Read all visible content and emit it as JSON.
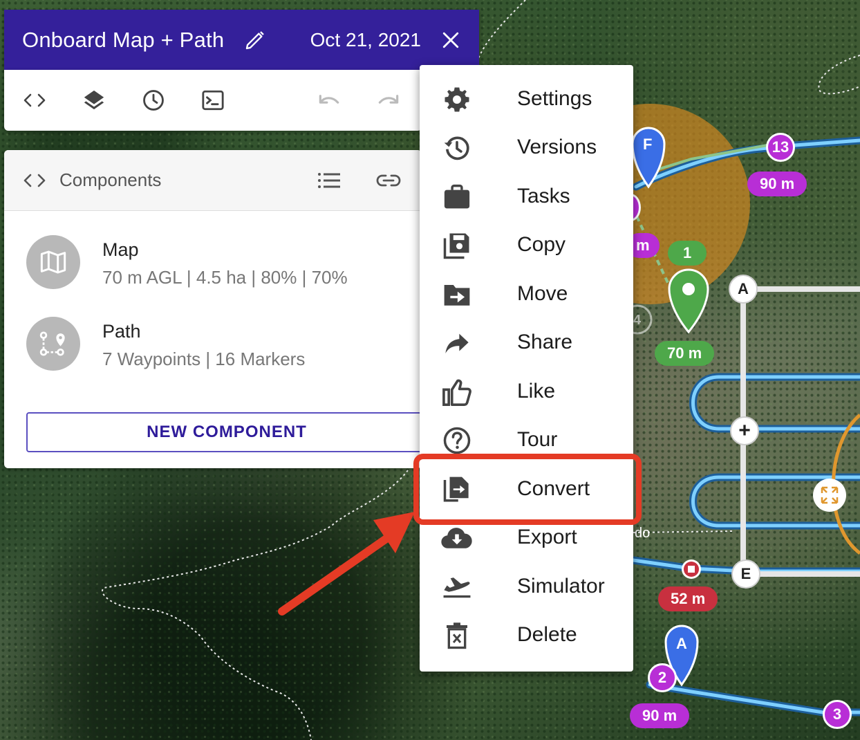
{
  "header": {
    "title": "Onboard Map + Path",
    "date": "Oct 21, 2021"
  },
  "panel": {
    "title": "Components",
    "components": [
      {
        "name": "Map",
        "meta": "70 m AGL | 4.5 ha | 80% | 70%",
        "icon": "map-icon"
      },
      {
        "name": "Path",
        "meta": "7 Waypoints | 16 Markers",
        "icon": "route-icon"
      }
    ],
    "new_button": "NEW COMPONENT"
  },
  "menu": {
    "items": [
      {
        "label": "Settings",
        "icon": "gear-icon"
      },
      {
        "label": "Versions",
        "icon": "history-icon"
      },
      {
        "label": "Tasks",
        "icon": "briefcase-icon"
      },
      {
        "label": "Copy",
        "icon": "save-copy-icon"
      },
      {
        "label": "Move",
        "icon": "folder-move-icon"
      },
      {
        "label": "Share",
        "icon": "share-arrow-icon"
      },
      {
        "label": "Like",
        "icon": "thumbs-up-icon"
      },
      {
        "label": "Tour",
        "icon": "help-circle-icon"
      },
      {
        "label": "Convert",
        "icon": "file-convert-icon"
      },
      {
        "label": "Export",
        "icon": "cloud-download-icon"
      },
      {
        "label": "Simulator",
        "icon": "airplane-takeoff-icon"
      },
      {
        "label": "Delete",
        "icon": "trash-icon"
      }
    ],
    "highlighted": "Convert"
  },
  "map": {
    "markers": {
      "pin_f": "F",
      "pin_a": "A",
      "wp_13": "13",
      "wp_2": "2",
      "wp_3": "3",
      "wp_1": "1",
      "alt_90_top": "90 m",
      "alt_90_bottom": "90 m",
      "alt_70": "70 m",
      "alt_52": "52 m",
      "alt_partial": "m",
      "corner_a": "A",
      "corner_e": "E",
      "plus": "+",
      "partial_4": "4",
      "road_label": "do"
    },
    "colors": {
      "path": "#3aa7ea",
      "waypoint": "#b82ed6",
      "takeoff": "#4ea84a",
      "landing": "#c8303f",
      "pin": "#3a6ee6",
      "header": "#34209a",
      "highlight": "#e43b25"
    }
  }
}
